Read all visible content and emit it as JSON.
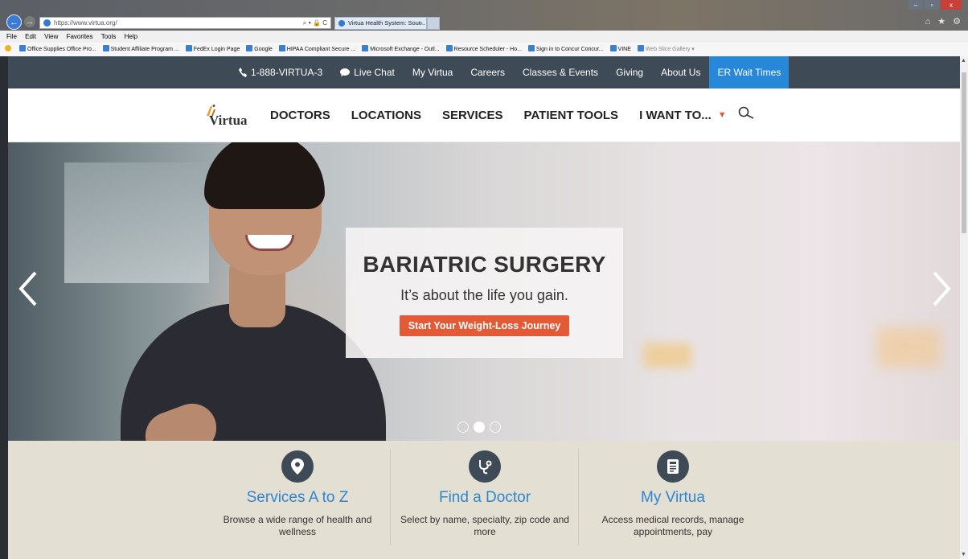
{
  "browser": {
    "url": "https://www.virtua.org/",
    "address_tools": "⌕ ▾ 🔒 C",
    "tab_title": "Virtua Health System: Sout...",
    "tab_close": "×",
    "window_controls": [
      "–",
      "▫",
      "x"
    ],
    "right_icons": "⌂ ★ ⚙",
    "menu": [
      "File",
      "Edit",
      "View",
      "Favorites",
      "Tools",
      "Help"
    ],
    "favorites": [
      "Office Supplies Office Pro...",
      "Student Affiliate Program ...",
      "FedEx Login Page",
      "Google",
      "HIPAA Compliant Secure ...",
      "Microsoft Exchange - Outl...",
      "Resource Scheduler - Ho...",
      "Sign in to Concur Concur...",
      "VINE",
      "Web Slice Gallery ▾"
    ]
  },
  "topnav": {
    "phone": "1-888-VIRTUA-3",
    "live_chat": "Live Chat",
    "my_virtua": "My Virtua",
    "careers": "Careers",
    "classes": "Classes & Events",
    "giving": "Giving",
    "about": "About Us",
    "er_wait": "ER Wait Times"
  },
  "mainnav": {
    "logo": "Virtua",
    "doctors": "DOCTORS",
    "locations": "LOCATIONS",
    "services": "SERVICES",
    "patient_tools": "PATIENT TOOLS",
    "i_want_to": "I WANT TO...",
    "caret": "▼"
  },
  "hero": {
    "title": "BARIATRIC SURGERY",
    "subtitle": "It’s about the life you gain.",
    "cta": "Start Your Weight-Loss Journey"
  },
  "features": [
    {
      "title": "Services A to Z",
      "desc": "Browse a wide range of health and wellness"
    },
    {
      "title": "Find a Doctor",
      "desc": "Select by name, specialty, zip code and more"
    },
    {
      "title": "My Virtua",
      "desc": "Access medical records, manage appointments, pay"
    }
  ],
  "colors": {
    "topnav_bg": "#3f4a57",
    "er_wait_bg": "#2787d9",
    "cta_bg": "#e45a37",
    "feature_title": "#2d86d2",
    "features_bg": "#e3dfd2"
  }
}
